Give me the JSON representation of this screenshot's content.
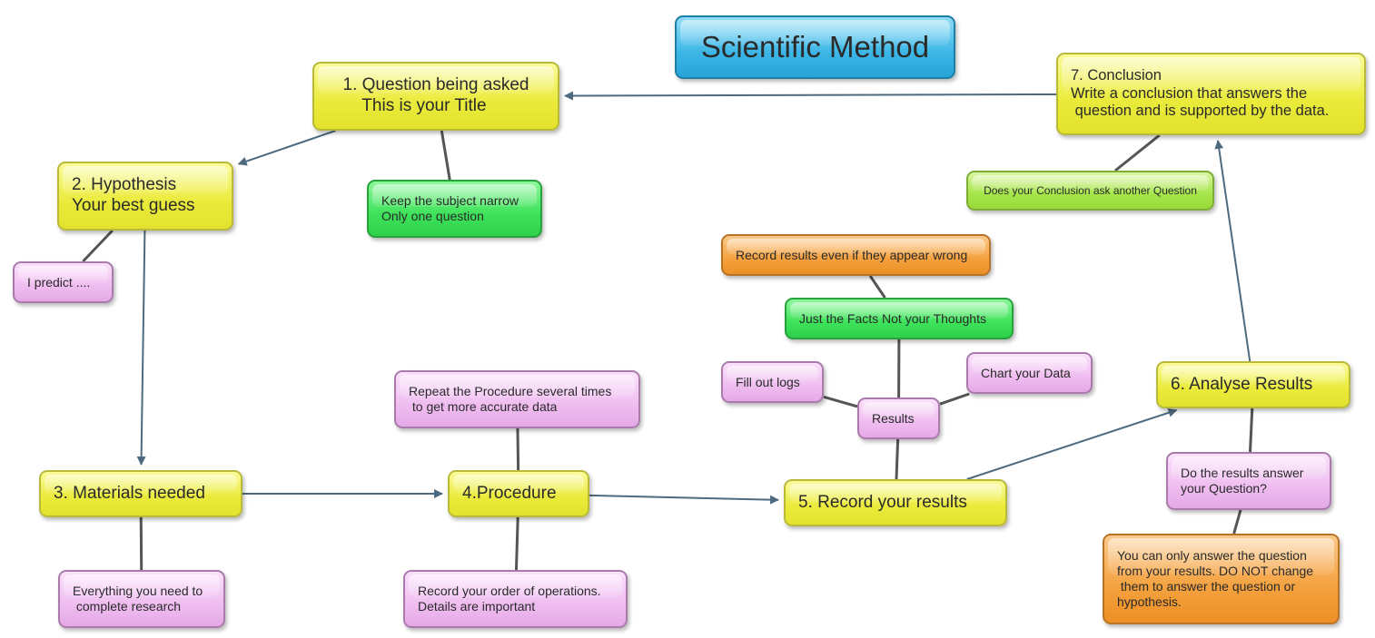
{
  "diagram": {
    "title": "Scientific Method",
    "colors": {
      "title_fill": "#3bb6e6",
      "step_fill": "#eaea3a",
      "green_note": "#3ee25a",
      "lime_note": "#a6e54a",
      "pink_note": "#efbdf0",
      "orange_note": "#f4a13e",
      "arrow": "#4e6a7e",
      "connector": "#555555"
    },
    "steps": [
      {
        "id": "q",
        "label": "1. Question being asked\n    This is your Title"
      },
      {
        "id": "h",
        "label": "2. Hypothesis\nYour best guess"
      },
      {
        "id": "m",
        "label": "3. Materials needed"
      },
      {
        "id": "p",
        "label": "4.Procedure"
      },
      {
        "id": "r",
        "label": "5. Record your results"
      },
      {
        "id": "a",
        "label": "6. Analyse Results"
      },
      {
        "id": "c",
        "label": "7. Conclusion\nWrite a conclusion that answers the\n question and is supported by the data."
      }
    ],
    "notes": [
      {
        "id": "n_narrow",
        "label": "Keep the subject narrow\nOnly one question",
        "attached_to": "q"
      },
      {
        "id": "n_predict",
        "label": "I predict ....",
        "attached_to": "h"
      },
      {
        "id": "n_everything",
        "label": "Everything you need to\n complete research",
        "attached_to": "m"
      },
      {
        "id": "n_repeat",
        "label": "Repeat the Procedure several times\n to get more accurate data",
        "attached_to": "p"
      },
      {
        "id": "n_order",
        "label": "Record your order of operations.\nDetails are important",
        "attached_to": "p"
      },
      {
        "id": "n_results",
        "label": "Results",
        "attached_to": "r"
      },
      {
        "id": "n_logs",
        "label": "Fill out logs",
        "attached_to": "n_results"
      },
      {
        "id": "n_chart",
        "label": "Chart your Data",
        "attached_to": "n_results"
      },
      {
        "id": "n_facts",
        "label": "Just the Facts Not your Thoughts",
        "attached_to": "n_results"
      },
      {
        "id": "n_wrong",
        "label": "Record results even if they appear wrong",
        "attached_to": "n_facts"
      },
      {
        "id": "n_answer",
        "label": "Do the results answer\nyour Question?",
        "attached_to": "a"
      },
      {
        "id": "n_only",
        "label": "You can only answer the question\nfrom your results. DO NOT change\n them to answer the question or\nhypothesis.",
        "attached_to": "n_answer"
      },
      {
        "id": "n_another",
        "label": "Does your Conclusion ask another Question",
        "attached_to": "c"
      }
    ],
    "flow": [
      {
        "from": "c",
        "to": "q"
      },
      {
        "from": "q",
        "to": "h"
      },
      {
        "from": "h",
        "to": "m"
      },
      {
        "from": "m",
        "to": "p"
      },
      {
        "from": "p",
        "to": "r"
      },
      {
        "from": "r",
        "to": "a"
      },
      {
        "from": "a",
        "to": "c"
      }
    ]
  }
}
